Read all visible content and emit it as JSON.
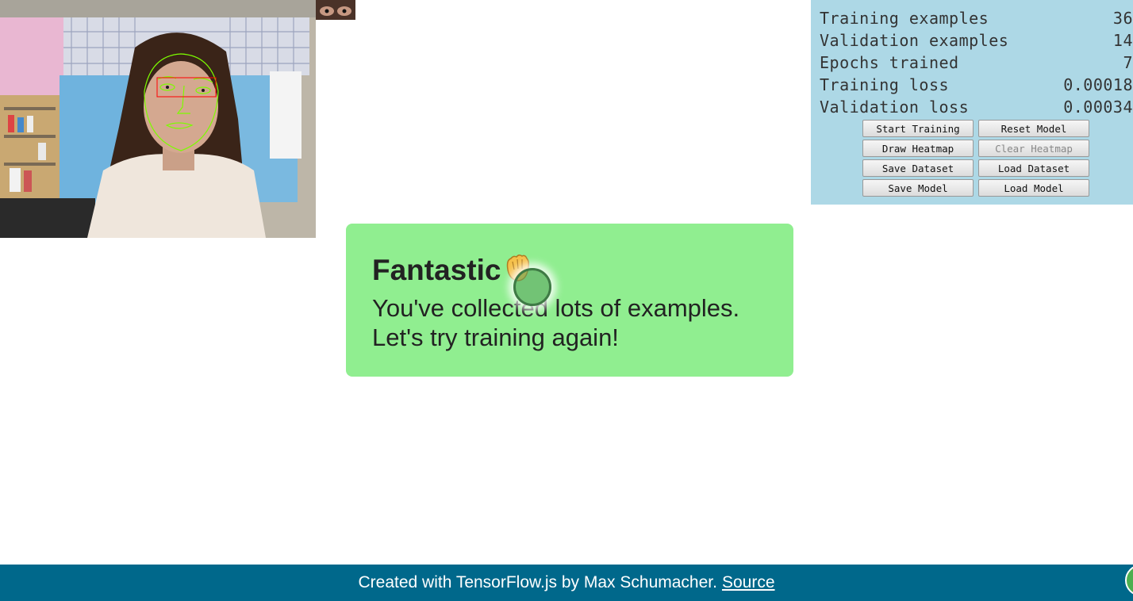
{
  "stats": [
    {
      "label": "Training examples",
      "value": "36"
    },
    {
      "label": "Validation examples",
      "value": "14"
    },
    {
      "label": "Epochs trained",
      "value": "7"
    },
    {
      "label": "Training loss",
      "value": "0.00018"
    },
    {
      "label": "Validation loss",
      "value": "0.00034"
    }
  ],
  "buttons": {
    "start_training": "Start Training",
    "reset_model": "Reset Model",
    "draw_heatmap": "Draw Heatmap",
    "clear_heatmap": "Clear Heatmap",
    "save_dataset": "Save Dataset",
    "load_dataset": "Load Dataset",
    "save_model": "Save Model",
    "load_model": "Load Model"
  },
  "message": {
    "title": "Fantastic",
    "icon": "waving-hand-icon",
    "line1": "You've collected lots of examples.",
    "line2": "Let's try training again!"
  },
  "footer": {
    "text": "Created with TensorFlow.js by Max Schumacher.",
    "link_label": "Source"
  },
  "colors": {
    "panel_bg": "#add8e6",
    "card_bg": "#90ee90",
    "footer_bg": "#00688b",
    "gaze_marker": "#3f7a45"
  }
}
